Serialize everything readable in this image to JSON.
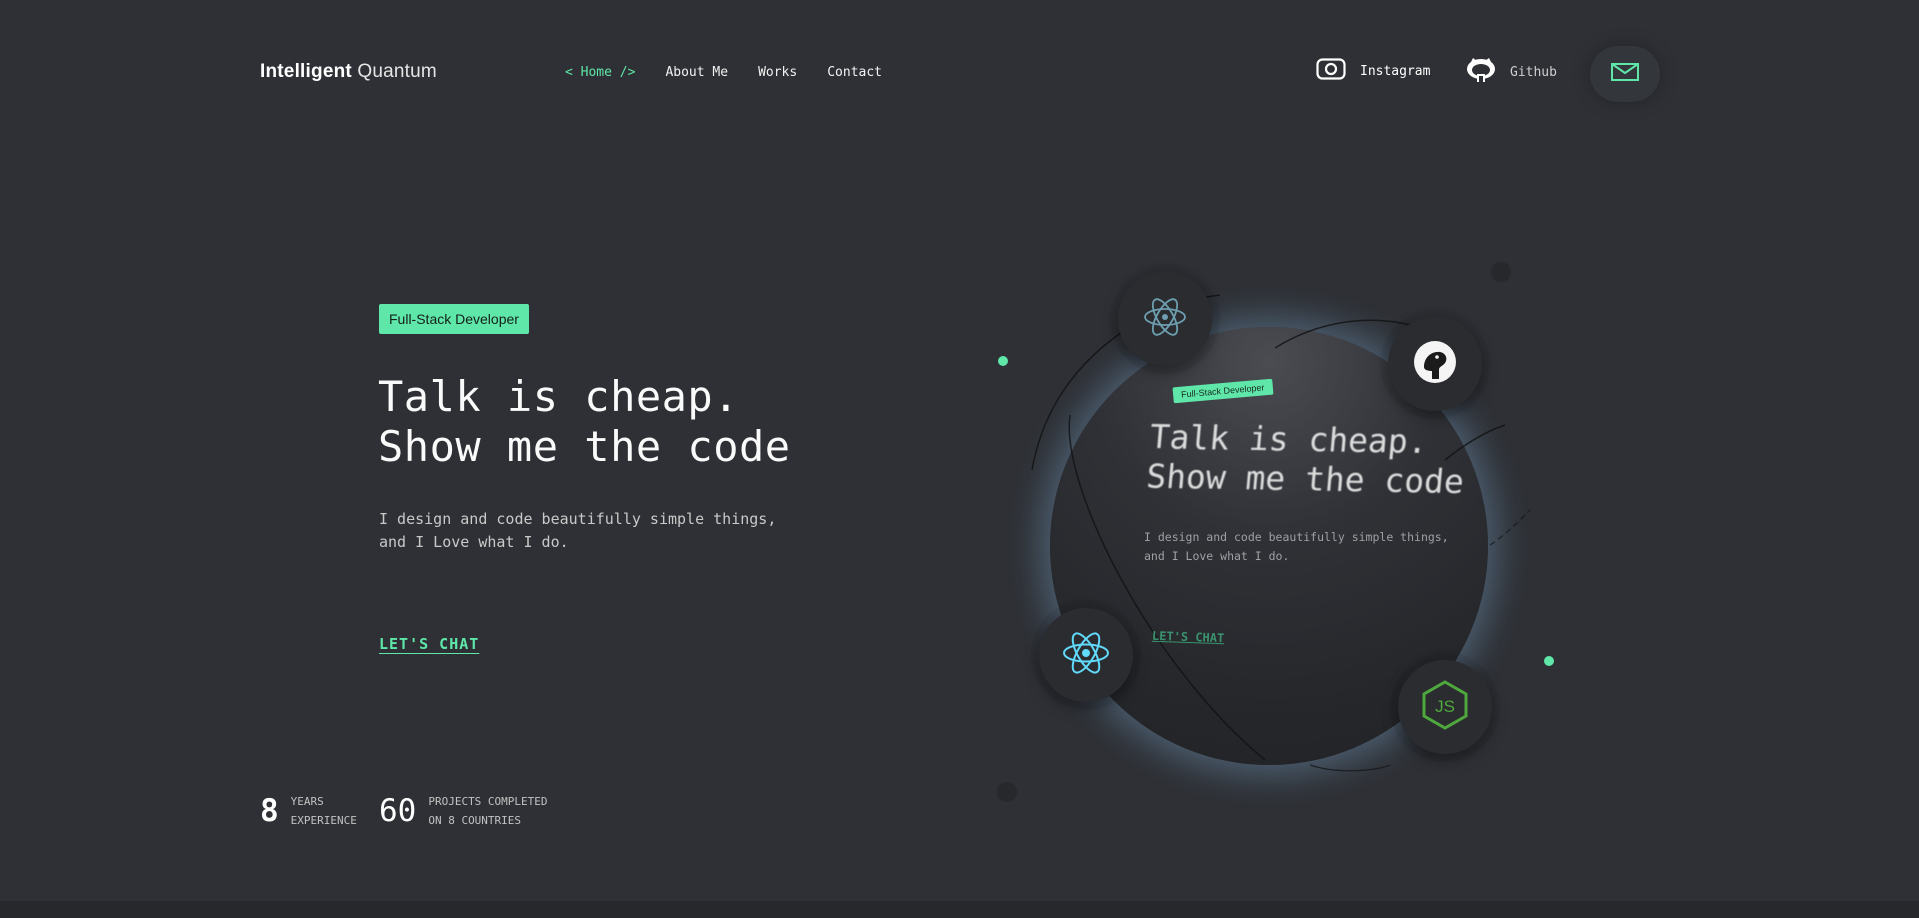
{
  "header": {
    "logo_bold": "Intelligent",
    "logo_light": "Quantum",
    "nav": [
      {
        "label": "< Home />",
        "active": true
      },
      {
        "label": "About Me",
        "active": false
      },
      {
        "label": "Works",
        "active": false
      },
      {
        "label": "Contact",
        "active": false
      }
    ],
    "social": {
      "instagram": "Instagram",
      "github": "Github"
    },
    "mail_icon": "envelope-icon"
  },
  "hero": {
    "badge": "Full-Stack Developer",
    "headline_line1": "Talk is cheap.",
    "headline_line2": "Show me the code",
    "sub_line1": "I design and code beautifully simple things,",
    "sub_line2": "and I Love what I do.",
    "cta": "LET'S CHAT"
  },
  "stats": [
    {
      "number": "8",
      "label_line1": "YEARS",
      "label_line2": "EXPERIENCE"
    },
    {
      "number": "60",
      "label_line1": "PROJECTS COMPLETED",
      "label_line2": "ON 8 COUNTRIES"
    }
  ],
  "orb": {
    "badge": "Full-Stack Developer",
    "headline_line1": "Talk is cheap.",
    "headline_line2": "Show me the code",
    "sub_line1": "I design and code beautifully simple things,",
    "sub_line2": "and I Love what I do.",
    "cta": "LET'S CHAT",
    "tech_icons": [
      "electron-icon",
      "deno-icon",
      "react-icon",
      "nodejs-icon"
    ]
  },
  "colors": {
    "background": "#2e3035",
    "accent": "#5ee7a8",
    "text": "#ffffff"
  }
}
